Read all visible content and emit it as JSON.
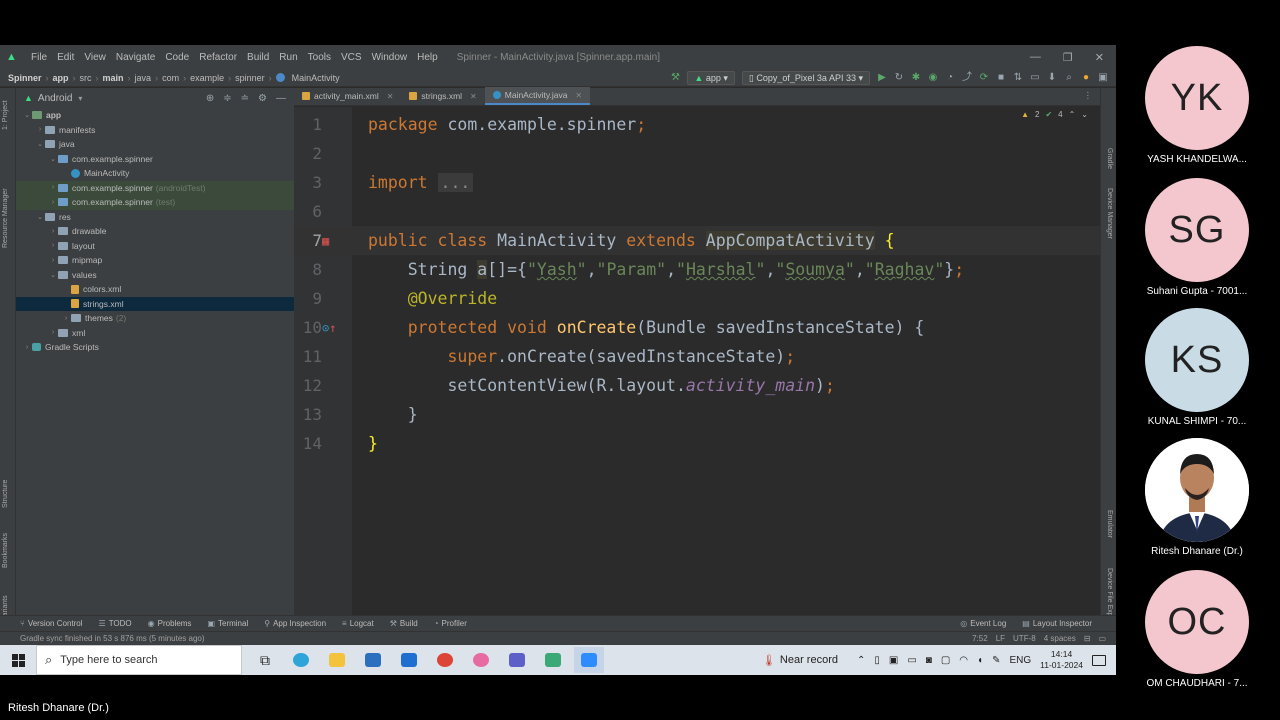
{
  "menubar": {
    "items": [
      "File",
      "Edit",
      "View",
      "Navigate",
      "Code",
      "Refactor",
      "Build",
      "Run",
      "Tools",
      "VCS",
      "Window",
      "Help"
    ],
    "window_title": "Spinner - MainActivity.java [Spinner.app.main]"
  },
  "navbar": {
    "crumbs": [
      "Spinner",
      "app",
      "src",
      "main",
      "java",
      "com",
      "example",
      "spinner",
      "MainActivity"
    ],
    "run_config": "app",
    "device": "Copy_of_Pixel 3a API 33"
  },
  "project_panel": {
    "view_mode": "Android",
    "tree": [
      {
        "label": "app",
        "depth": 0,
        "kind": "module",
        "open": true
      },
      {
        "label": "manifests",
        "depth": 1,
        "kind": "folder",
        "open": false
      },
      {
        "label": "java",
        "depth": 1,
        "kind": "folder",
        "open": true
      },
      {
        "label": "com.example.spinner",
        "depth": 2,
        "kind": "package",
        "open": true
      },
      {
        "label": "MainActivity",
        "depth": 3,
        "kind": "class"
      },
      {
        "label": "com.example.spinner",
        "note": "(androidTest)",
        "depth": 2,
        "kind": "package-test",
        "open": false
      },
      {
        "label": "com.example.spinner",
        "note": "(test)",
        "depth": 2,
        "kind": "package-test",
        "open": false
      },
      {
        "label": "res",
        "depth": 1,
        "kind": "folder",
        "open": true
      },
      {
        "label": "drawable",
        "depth": 2,
        "kind": "folder",
        "open": false
      },
      {
        "label": "layout",
        "depth": 2,
        "kind": "folder",
        "open": false
      },
      {
        "label": "mipmap",
        "depth": 2,
        "kind": "folder",
        "open": false
      },
      {
        "label": "values",
        "depth": 2,
        "kind": "folder",
        "open": true
      },
      {
        "label": "colors.xml",
        "depth": 3,
        "kind": "xml"
      },
      {
        "label": "strings.xml",
        "depth": 3,
        "kind": "xml",
        "selected": true
      },
      {
        "label": "themes",
        "note": "(2)",
        "depth": 3,
        "kind": "folder",
        "open": false
      },
      {
        "label": "xml",
        "depth": 2,
        "kind": "folder",
        "open": false
      },
      {
        "label": "Gradle Scripts",
        "depth": 0,
        "kind": "gradle",
        "open": false
      }
    ]
  },
  "tabs": [
    {
      "label": "activity_main.xml",
      "active": false,
      "color": "#d9a441"
    },
    {
      "label": "strings.xml",
      "active": false,
      "color": "#d9a441"
    },
    {
      "label": "MainActivity.java",
      "active": true,
      "color": "#3592c4"
    }
  ],
  "editor": {
    "warnings": "2",
    "checks": "4",
    "line_numbers": [
      "1",
      "2",
      "3",
      "6",
      "7",
      "8",
      "9",
      "10",
      "11",
      "12",
      "13",
      "14"
    ],
    "current_line": "7"
  },
  "bottom_tools": {
    "left": [
      "Version Control",
      "TODO",
      "Problems",
      "Terminal",
      "App Inspection",
      "Logcat",
      "Build",
      "Profiler"
    ],
    "right": [
      "Event Log",
      "Layout Inspector"
    ]
  },
  "statusbar": {
    "message": "Gradle sync finished in 53 s 876 ms (5 minutes ago)",
    "position": "7:52",
    "line_sep": "LF",
    "encoding": "UTF-8",
    "indent": "4 spaces"
  },
  "taskbar": {
    "search_placeholder": "Type here to search",
    "near_record": "Near record",
    "lang": "ENG",
    "time": "14:14",
    "date": "11-01-2024"
  },
  "participants": [
    {
      "initials": "YK",
      "name": "YASH KHANDELWA...",
      "color": "#f4c7cf"
    },
    {
      "initials": "SG",
      "name": "Suhani Gupta - 7001...",
      "color": "#f4c7cf"
    },
    {
      "initials": "KS",
      "name": "KUNAL SHIMPI - 70...",
      "color": "#c9dce6"
    },
    {
      "initials": "",
      "name": "Ritesh Dhanare (Dr.)",
      "color": "#ffffff"
    },
    {
      "initials": "OC",
      "name": "OM CHAUDHARI - 7...",
      "color": "#f4c7cf"
    }
  ],
  "presenter_label": "Ritesh Dhanare (Dr.)"
}
